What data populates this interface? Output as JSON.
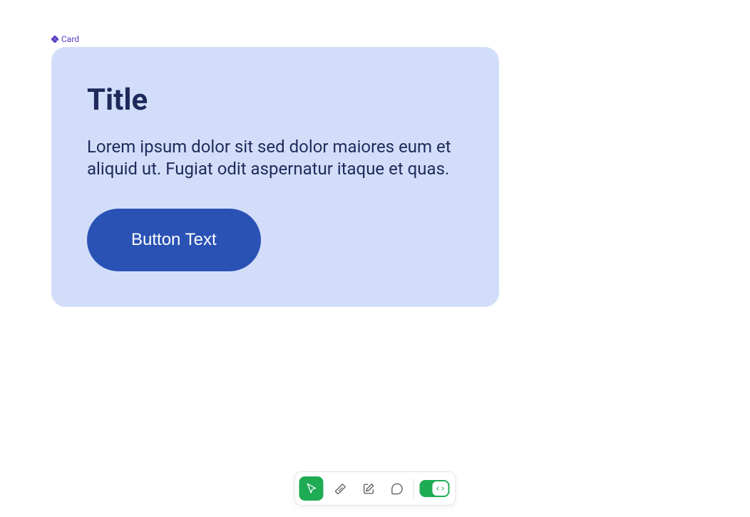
{
  "component": {
    "label": "Card"
  },
  "card": {
    "title": "Title",
    "body": "Lorem ipsum dolor sit sed dolor maiores eum et aliquid ut. Fugiat odit aspernatur itaque et quas.",
    "button_label": "Button Text"
  },
  "toolbar": {
    "tools": [
      {
        "name": "select",
        "icon": "cursor",
        "active": true
      },
      {
        "name": "measure",
        "icon": "ruler",
        "active": false
      },
      {
        "name": "edit",
        "icon": "pencil-square",
        "active": false
      },
      {
        "name": "comment",
        "icon": "chat",
        "active": false
      }
    ],
    "dev_mode_enabled": true
  }
}
